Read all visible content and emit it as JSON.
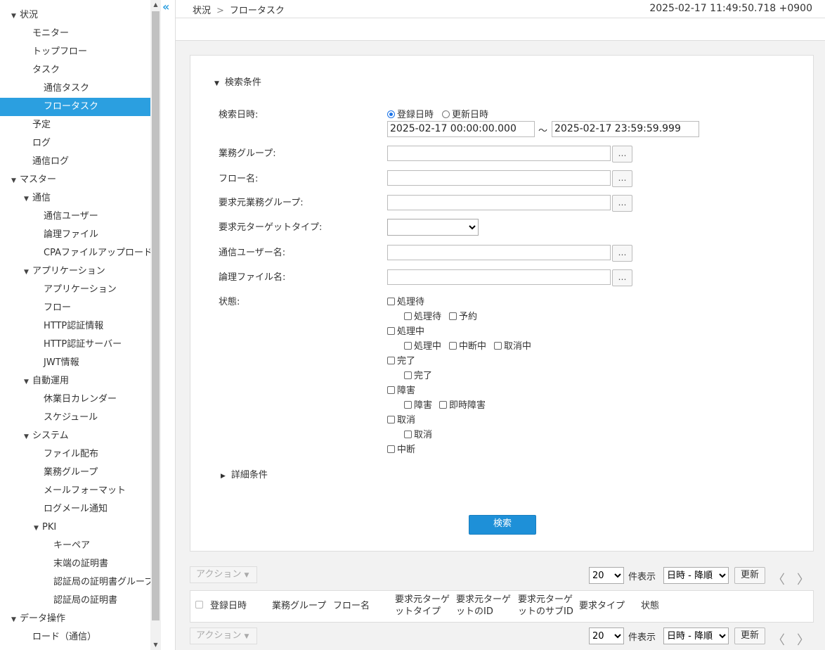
{
  "sidebar": {
    "items": [
      {
        "label": "状況",
        "level": 0,
        "expanded": true
      },
      {
        "label": "モニター",
        "level": 1
      },
      {
        "label": "トップフロー",
        "level": 1
      },
      {
        "label": "タスク",
        "level": 1
      },
      {
        "label": "通信タスク",
        "level": 2
      },
      {
        "label": "フロータスク",
        "level": 2,
        "selected": true
      },
      {
        "label": "予定",
        "level": 1
      },
      {
        "label": "ログ",
        "level": 1
      },
      {
        "label": "通信ログ",
        "level": 1
      },
      {
        "label": "マスター",
        "level": 0,
        "expanded": true
      },
      {
        "label": "通信",
        "level": 1,
        "expanded": true
      },
      {
        "label": "通信ユーザー",
        "level": 2
      },
      {
        "label": "論理ファイル",
        "level": 2
      },
      {
        "label": "CPAファイルアップロード",
        "level": 2
      },
      {
        "label": "アプリケーション",
        "level": 1,
        "expanded": true
      },
      {
        "label": "アプリケーション",
        "level": 2
      },
      {
        "label": "フロー",
        "level": 2
      },
      {
        "label": "HTTP認証情報",
        "level": 2
      },
      {
        "label": "HTTP認証サーバー",
        "level": 2
      },
      {
        "label": "JWT情報",
        "level": 2
      },
      {
        "label": "自動運用",
        "level": 1,
        "expanded": true
      },
      {
        "label": "休業日カレンダー",
        "level": 2
      },
      {
        "label": "スケジュール",
        "level": 2
      },
      {
        "label": "システム",
        "level": 1,
        "expanded": true
      },
      {
        "label": "ファイル配布",
        "level": 2
      },
      {
        "label": "業務グループ",
        "level": 2
      },
      {
        "label": "メールフォーマット",
        "level": 2
      },
      {
        "label": "ログメール通知",
        "level": 2
      },
      {
        "label": "PKI",
        "level": 2,
        "expanded": true
      },
      {
        "label": "キーペア",
        "level": 3
      },
      {
        "label": "末端の証明書",
        "level": 3
      },
      {
        "label": "認証局の証明書グループ",
        "level": 3
      },
      {
        "label": "認証局の証明書",
        "level": 3
      },
      {
        "label": "データ操作",
        "level": 0,
        "expanded": true
      },
      {
        "label": "ロード（通信）",
        "level": 1
      }
    ]
  },
  "header": {
    "breadcrumb": [
      "状況",
      "フロータスク"
    ],
    "clock": "2025-02-17 11:49:50.718 +0900",
    "collapse_icon": "«"
  },
  "search": {
    "section_label": "検索条件",
    "date_label": "検索日時:",
    "radio_registered": "登録日時",
    "radio_updated": "更新日時",
    "date_from": "2025-02-17 00:00:00.000",
    "date_sep": "～",
    "date_to": "2025-02-17 23:59:59.999",
    "business_group_label": "業務グループ:",
    "flow_name_label": "フロー名:",
    "req_business_group_label": "要求元業務グループ:",
    "req_target_type_label": "要求元ターゲットタイプ:",
    "comm_user_label": "通信ユーザー名:",
    "logical_file_label": "論理ファイル名:",
    "picker_glyph": "…",
    "status_label": "状態:",
    "status": {
      "waiting": "処理待",
      "waiting_sub1": "処理待",
      "waiting_sub2": "予約",
      "processing": "処理中",
      "processing_sub1": "処理中",
      "processing_sub2": "中断中",
      "processing_sub3": "取消中",
      "done": "完了",
      "done_sub1": "完了",
      "fault": "障害",
      "fault_sub1": "障害",
      "fault_sub2": "即時障害",
      "cancel": "取消",
      "cancel_sub1": "取消",
      "interrupt": "中断"
    },
    "detail_label": "詳細条件",
    "search_button": "検索"
  },
  "results": {
    "action_label": "アクション",
    "page_size": "20",
    "page_size_suffix": "件表示",
    "sort": "日時 - 降順",
    "refresh": "更新",
    "prev": "〈",
    "next": "〉",
    "columns": [
      "登録日時",
      "業務グループ",
      "フロー名",
      "要求元ターゲットタイプ",
      "要求元ターゲットのID",
      "要求元ターゲットのサブID",
      "要求タイプ",
      "状態"
    ],
    "col_lines": [
      [
        "登録日時"
      ],
      [
        "業務グループ"
      ],
      [
        "フロー名"
      ],
      [
        "要求元ターゲ",
        "ットタイプ"
      ],
      [
        "要求元ターゲ",
        "ットのID"
      ],
      [
        "要求元ターゲ",
        "ットのサブID"
      ],
      [
        "要求タイプ"
      ],
      [
        "状態"
      ]
    ]
  }
}
